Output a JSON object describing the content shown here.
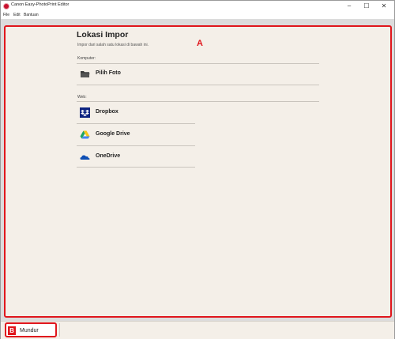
{
  "window": {
    "title": "Canon Easy-PhotoPrint Editor",
    "minimize": "─",
    "maximize": "☐",
    "close": "✕"
  },
  "menu": {
    "items": [
      {
        "label": "File"
      },
      {
        "label": "Edit"
      },
      {
        "label": "Bantuan"
      }
    ]
  },
  "callouts": {
    "a": "A",
    "b": "B"
  },
  "page": {
    "title": "Lokasi Impor",
    "description": "Impor dari salah satu lokasi di bawah ini."
  },
  "sections": {
    "computer": {
      "label": "Komputer:",
      "items": [
        {
          "label": "Pilih Foto",
          "icon": "folder-icon"
        }
      ]
    },
    "web": {
      "label": "Web:",
      "items": [
        {
          "label": "Dropbox",
          "icon": "dropbox-icon"
        },
        {
          "label": "Google Drive",
          "icon": "google-drive-icon"
        },
        {
          "label": "OneDrive",
          "icon": "onedrive-icon"
        }
      ]
    }
  },
  "footer": {
    "back_label": "Mundur"
  },
  "colors": {
    "accent_red": "#e0161c",
    "content_bg": "#f4efe8",
    "dropbox_blue": "#0d2481",
    "onedrive_blue": "#0f4fb4"
  }
}
